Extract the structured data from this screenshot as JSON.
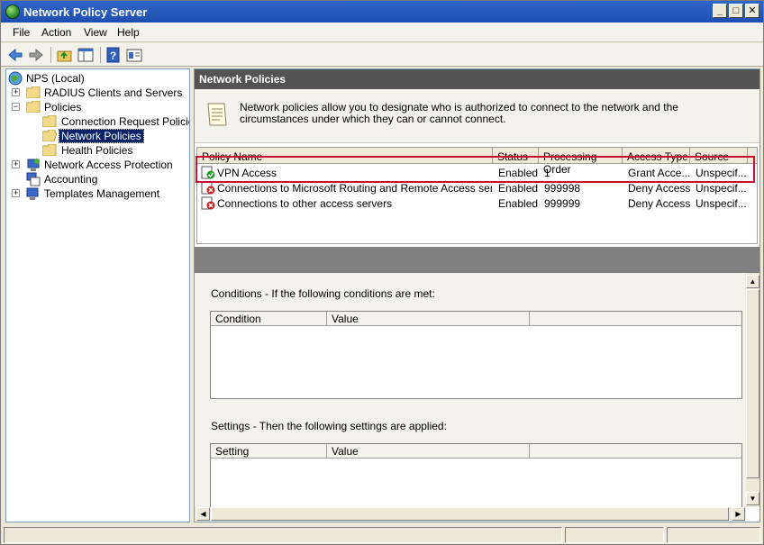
{
  "window": {
    "title": "Network Policy Server"
  },
  "menu": [
    "File",
    "Action",
    "View",
    "Help"
  ],
  "toolbar": {
    "icons": [
      "back-arrow-icon",
      "forward-arrow-icon",
      "up-folder-icon",
      "show-hide-tree-icon",
      "help-icon",
      "properties-icon"
    ]
  },
  "tree": {
    "items": [
      {
        "label": "NPS (Local)",
        "icon": "nps-globe-icon"
      },
      {
        "label": "RADIUS Clients and Servers",
        "icon": "folder-icon",
        "expander": "+"
      },
      {
        "label": "Policies",
        "icon": "folder-icon",
        "expander": "-"
      },
      {
        "label": "Connection Request Policies",
        "icon": "folder-icon"
      },
      {
        "label": "Network Policies",
        "icon": "folder-open-icon",
        "selected": true
      },
      {
        "label": "Health Policies",
        "icon": "folder-icon"
      },
      {
        "label": "Network Access Protection",
        "icon": "nap-computer-icon",
        "expander": "+"
      },
      {
        "label": "Accounting",
        "icon": "accounting-icon"
      },
      {
        "label": "Templates Management",
        "icon": "templates-icon",
        "expander": "+"
      }
    ]
  },
  "main": {
    "header": "Network Policies",
    "description": "Network policies allow you to designate who is authorized to connect to the network and the circumstances under which they can or cannot connect.",
    "columns": [
      "Policy Name",
      "Status",
      "Processing Order",
      "Access Type",
      "Source"
    ],
    "rows": [
      {
        "name": "VPN Access",
        "status": "Enabled",
        "order": "1",
        "access": "Grant Acce...",
        "source": "Unspecif...",
        "icon": "grant-policy-icon"
      },
      {
        "name": "Connections to Microsoft Routing and Remote Access server",
        "status": "Enabled",
        "order": "999998",
        "access": "Deny Access",
        "source": "Unspecif...",
        "icon": "deny-policy-icon"
      },
      {
        "name": "Connections to other access servers",
        "status": "Enabled",
        "order": "999999",
        "access": "Deny Access",
        "source": "Unspecif...",
        "icon": "deny-policy-icon"
      }
    ],
    "conditions": {
      "label": "Conditions - If the following conditions are met:",
      "columns": [
        "Condition",
        "Value"
      ]
    },
    "settings": {
      "label": "Settings - Then the following settings are applied:",
      "columns": [
        "Setting",
        "Value"
      ]
    }
  },
  "colors": {
    "title_bar": "#2f66c8",
    "header_band": "#535353",
    "highlight": "#c8102e",
    "selection": "#0a246a"
  }
}
